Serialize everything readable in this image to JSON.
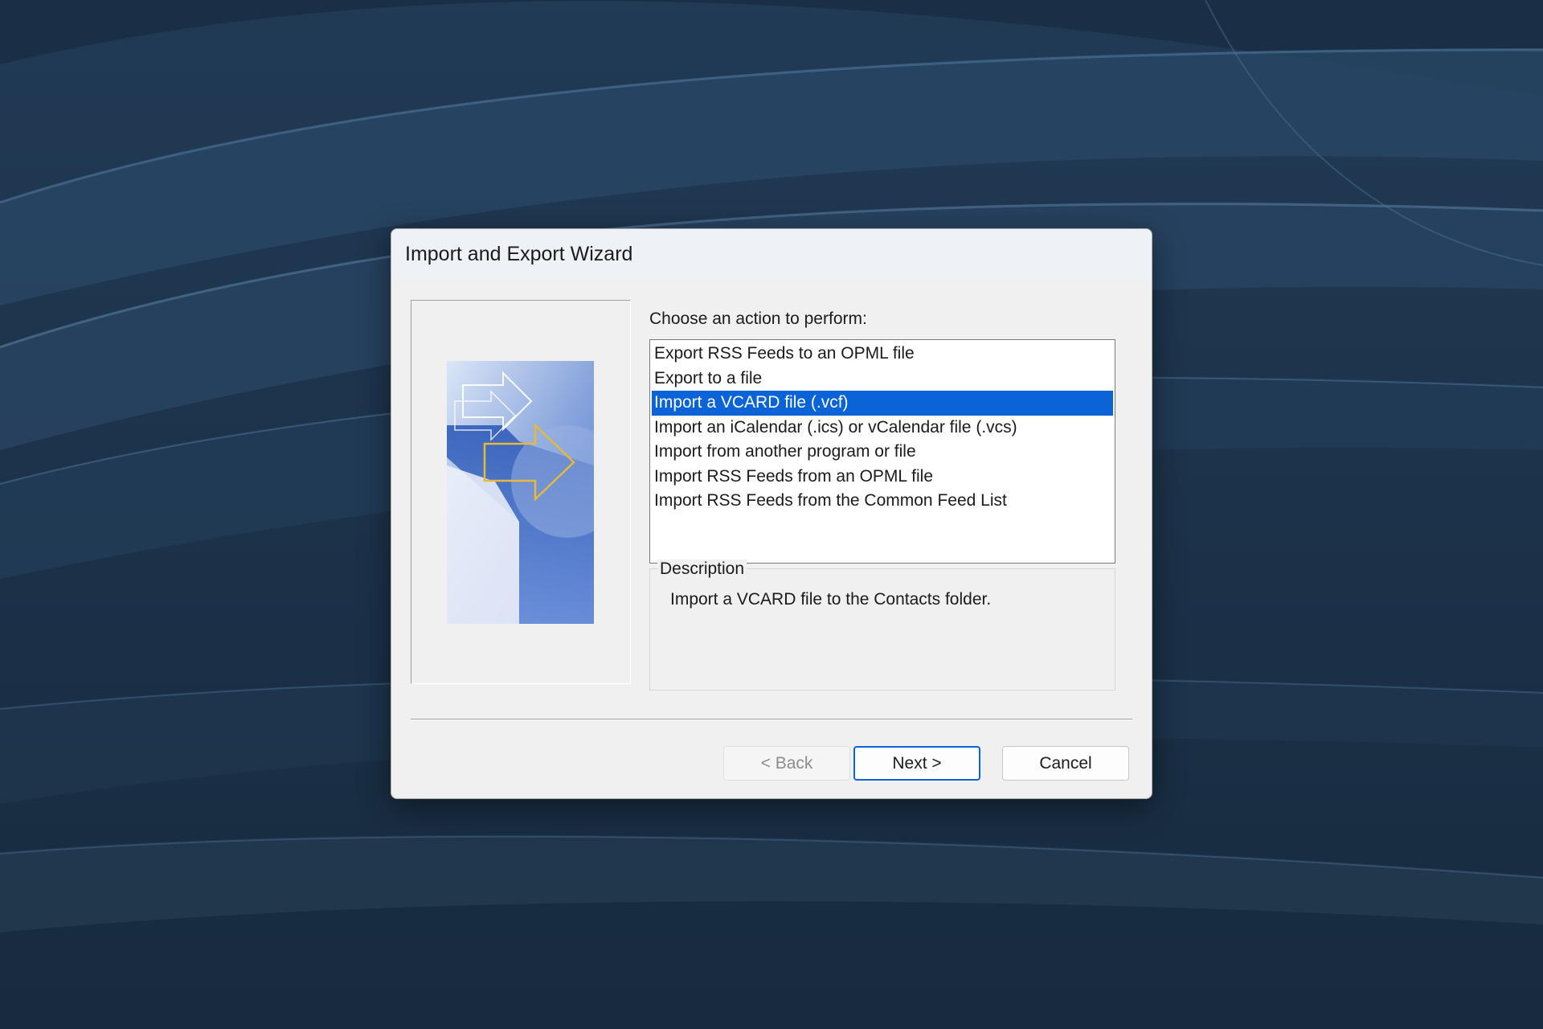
{
  "window": {
    "title": "Import and Export Wizard"
  },
  "wizard": {
    "prompt": "Choose an action to perform:",
    "actions": [
      {
        "label": "Export RSS Feeds to an OPML file",
        "selected": false
      },
      {
        "label": "Export to a file",
        "selected": false
      },
      {
        "label": "Import a VCARD file (.vcf)",
        "selected": true
      },
      {
        "label": "Import an iCalendar (.ics) or vCalendar file (.vcs)",
        "selected": false
      },
      {
        "label": "Import from another program or file",
        "selected": false
      },
      {
        "label": "Import RSS Feeds from an OPML file",
        "selected": false
      },
      {
        "label": "Import RSS Feeds from the Common Feed List",
        "selected": false
      }
    ],
    "description_label": "Description",
    "description_text": "Import a VCARD file to the Contacts folder."
  },
  "buttons": {
    "back": "< Back",
    "next": "Next >",
    "cancel": "Cancel"
  },
  "colors": {
    "selection": "#0a64d8",
    "desktop": "#1c3148",
    "dialog": "#f0f0f0"
  }
}
